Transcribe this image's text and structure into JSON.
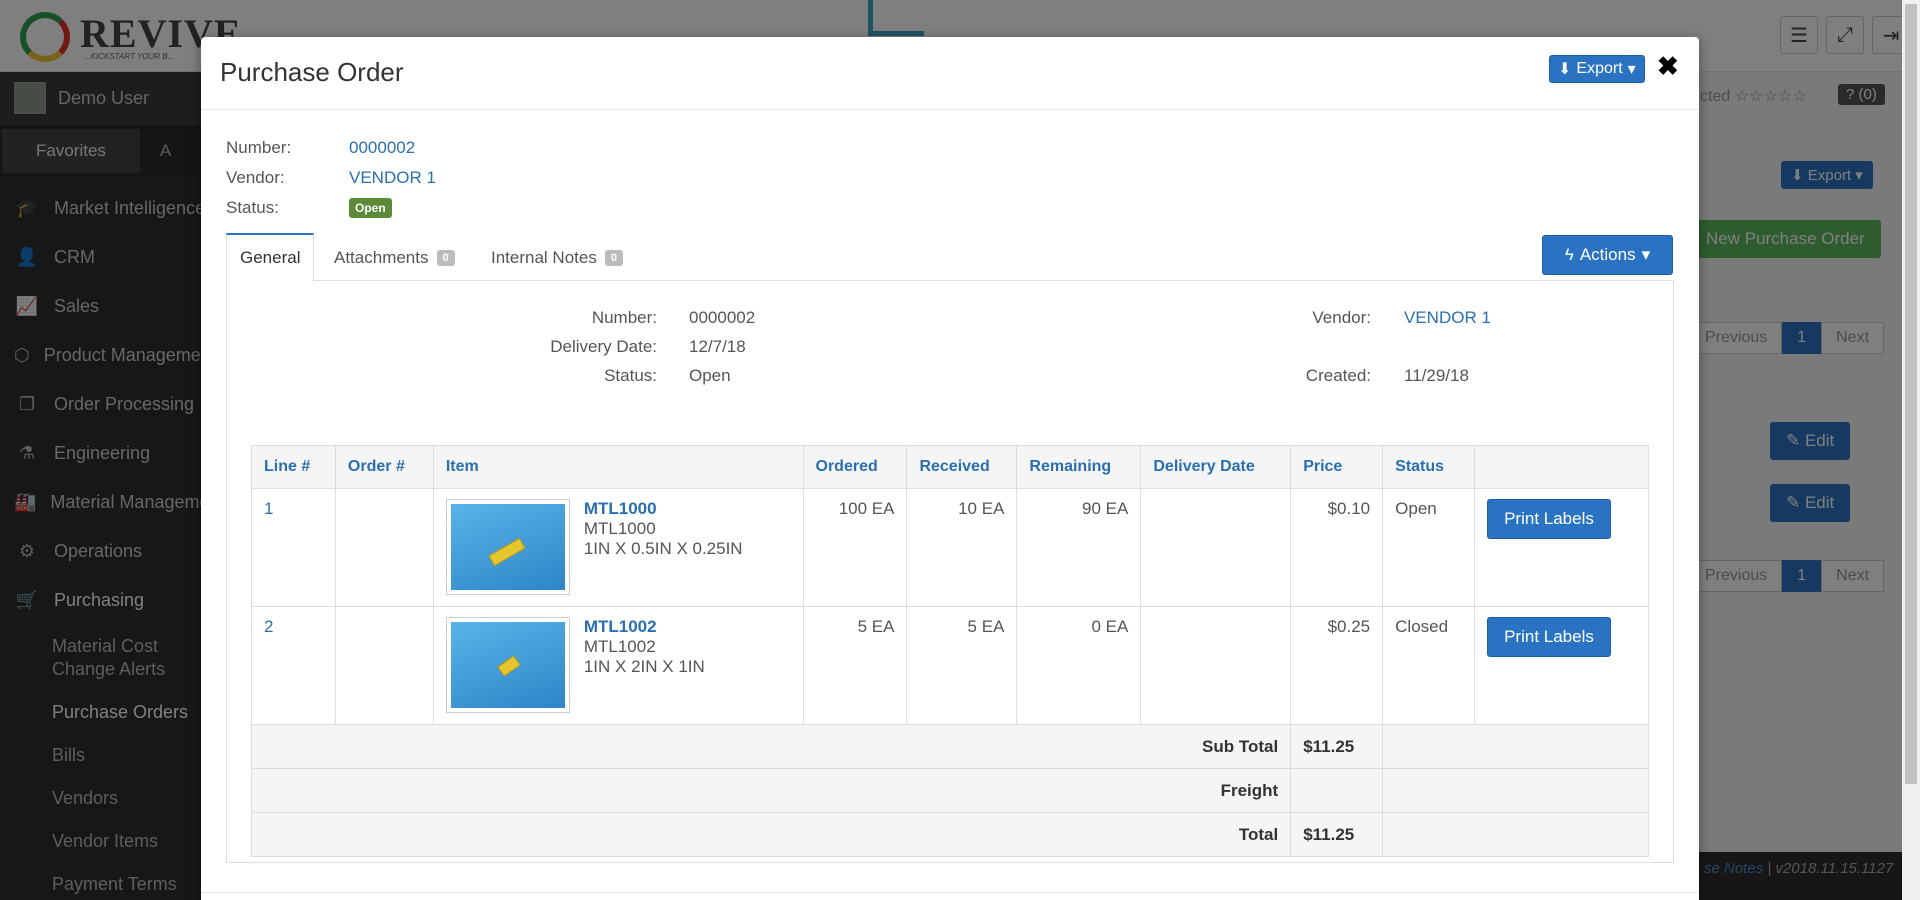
{
  "brand": {
    "logo_text": "REVIVE",
    "logo_tagline": "...KICKSTART YOUR B..."
  },
  "user": {
    "name": "Demo User"
  },
  "sidebar": {
    "tabs": [
      "Favorites",
      "A"
    ],
    "items": [
      {
        "label": "Market Intelligence",
        "icon": "graduation-cap-icon",
        "glyph": "🎓"
      },
      {
        "label": "CRM",
        "icon": "user-icon",
        "glyph": "👤"
      },
      {
        "label": "Sales",
        "icon": "line-chart-icon",
        "glyph": "📈"
      },
      {
        "label": "Product Management",
        "icon": "cube-icon",
        "glyph": "⬡"
      },
      {
        "label": "Order Processing",
        "icon": "copy-icon",
        "glyph": "❐"
      },
      {
        "label": "Engineering",
        "icon": "flask-icon",
        "glyph": "⚗"
      },
      {
        "label": "Material Management",
        "icon": "industry-icon",
        "glyph": "🏭"
      },
      {
        "label": "Operations",
        "icon": "cogs-icon",
        "glyph": "⚙"
      },
      {
        "label": "Purchasing",
        "icon": "cart-icon",
        "glyph": "🛒"
      }
    ],
    "sub_items": [
      "Material Cost Change Alerts",
      "Purchase Orders",
      "Bills",
      "Vendors",
      "Vendor Items",
      "Payment Terms"
    ]
  },
  "background": {
    "rating_text": "cted ☆☆☆☆☆",
    "help_text": "? (0)",
    "export_label": "Export",
    "new_po_label": "New Purchase Order",
    "pager": {
      "previous": "Previous",
      "page": "1",
      "next": "Next"
    },
    "edit_label": "Edit",
    "footer_link": "se Notes",
    "footer_version": " | v2018.11.15.1127"
  },
  "modal": {
    "title": "Purchase Order",
    "export_label": "Export",
    "close_glyph": "✖",
    "meta": {
      "number_label": "Number:",
      "number": "0000002",
      "vendor_label": "Vendor:",
      "vendor": "VENDOR 1",
      "status_label": "Status:",
      "status": "Open"
    },
    "tabs": [
      {
        "label": "General",
        "count": ""
      },
      {
        "label": "Attachments",
        "count": "0"
      },
      {
        "label": "Internal Notes",
        "count": "0"
      }
    ],
    "actions_label": "Actions",
    "details": {
      "number_label": "Number:",
      "number": "0000002",
      "delivery_label": "Delivery Date:",
      "delivery": "12/7/18",
      "status_label": "Status:",
      "status": "Open",
      "vendor_label": "Vendor:",
      "vendor": "VENDOR 1",
      "created_label": "Created:",
      "created": "11/29/18"
    },
    "table": {
      "headers": [
        "Line #",
        "Order #",
        "Item",
        "Ordered",
        "Received",
        "Remaining",
        "Delivery Date",
        "Price",
        "Status",
        ""
      ],
      "rows": [
        {
          "line": "1",
          "order": "",
          "item_code": "MTL1000",
          "item_sub": "MTL1000",
          "item_dims": "1IN X 0.5IN X 0.25IN",
          "ordered": "100 EA",
          "received": "10 EA",
          "remaining": "90 EA",
          "delivery": "",
          "price": "$0.10",
          "status": "Open",
          "action": "Print Labels"
        },
        {
          "line": "2",
          "order": "",
          "item_code": "MTL1002",
          "item_sub": "MTL1002",
          "item_dims": "1IN X 2IN X 1IN",
          "ordered": "5 EA",
          "received": "5 EA",
          "remaining": "0 EA",
          "delivery": "",
          "price": "$0.25",
          "status": "Closed",
          "action": "Print Labels"
        }
      ],
      "subtotal_label": "Sub Total",
      "subtotal": "$11.25",
      "freight_label": "Freight",
      "freight": "",
      "total_label": "Total",
      "total": "$11.25"
    }
  },
  "colors": {
    "primary": "#2a73c2",
    "link": "#2a6fb0",
    "success": "#5cb85c",
    "badge_open": "#5c8a3a"
  }
}
